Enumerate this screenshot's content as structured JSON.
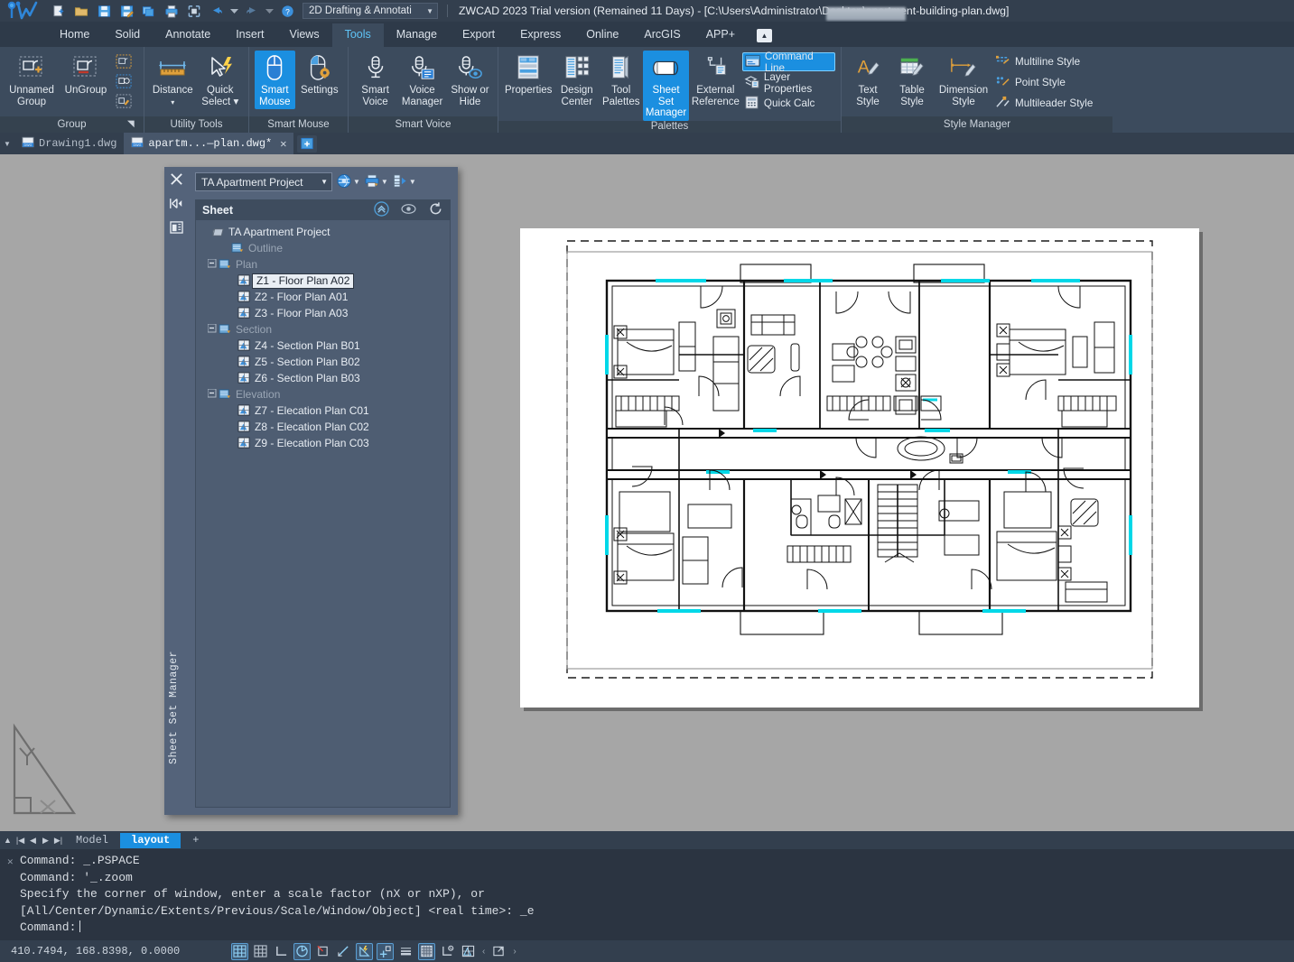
{
  "titlebar": {
    "workspace": "2D Drafting & Annotati",
    "title_prefix": "ZWCAD 2023 Trial version (Remained 11 Days) - [C:\\Users\\Administrator\\Desktop",
    "title_suffix": "\\apartment-building-plan.dwg]",
    "quick_access": [
      {
        "name": "new-icon",
        "label": "New"
      },
      {
        "name": "open-folder-icon",
        "label": "Open"
      },
      {
        "name": "save-icon",
        "label": "Save"
      },
      {
        "name": "save-as-icon",
        "label": "Save As"
      },
      {
        "name": "batch-plot-icon",
        "label": "Batch Plot"
      },
      {
        "name": "print-icon",
        "label": "Plot"
      },
      {
        "name": "print-preview-icon",
        "label": "Print Preview"
      },
      {
        "name": "undo-icon",
        "label": "Undo"
      },
      {
        "name": "undo-dropdown-icon",
        "label": "Undo list"
      },
      {
        "name": "redo-icon",
        "label": "Redo"
      },
      {
        "name": "redo-dropdown-icon",
        "label": "Redo list"
      },
      {
        "name": "help-icon",
        "label": "Help"
      }
    ]
  },
  "ribbon_tabs": [
    {
      "label": "Home",
      "active": false
    },
    {
      "label": "Solid",
      "active": false
    },
    {
      "label": "Annotate",
      "active": false
    },
    {
      "label": "Insert",
      "active": false
    },
    {
      "label": "Views",
      "active": false
    },
    {
      "label": "Tools",
      "active": true
    },
    {
      "label": "Manage",
      "active": false
    },
    {
      "label": "Export",
      "active": false
    },
    {
      "label": "Express",
      "active": false
    },
    {
      "label": "Online",
      "active": false
    },
    {
      "label": "ArcGIS",
      "active": false
    },
    {
      "label": "APP+",
      "active": false
    }
  ],
  "ribbon": {
    "groups": [
      {
        "title": "Group",
        "has_launcher": true,
        "buttons": [
          {
            "label": "Unnamed\nGroup",
            "line1": "Unnamed",
            "line2": "Group",
            "icon": "unnamed-group-icon",
            "selected": false
          },
          {
            "label": "UnGroup",
            "line1": "UnGroup",
            "line2": "",
            "icon": "ungroup-icon",
            "selected": false
          }
        ],
        "small_icons": [
          {
            "name": "group-edit-icon"
          },
          {
            "name": "group-select-icon"
          },
          {
            "name": "group-manager-icon"
          }
        ]
      },
      {
        "title": "Utility Tools",
        "has_launcher": false,
        "buttons": [
          {
            "line1": "Distance",
            "line2": "▾",
            "icon": "distance-icon",
            "selected": false
          },
          {
            "line1": "Quick",
            "line2": "Select ▾",
            "icon": "quick-select-icon",
            "selected": false
          }
        ],
        "small_icons": []
      },
      {
        "title": "Smart Mouse",
        "has_launcher": false,
        "buttons": [
          {
            "line1": "Smart",
            "line2": "Mouse",
            "icon": "smart-mouse-icon",
            "selected": true
          },
          {
            "line1": "Settings",
            "line2": "",
            "icon": "smart-mouse-settings-icon",
            "selected": false
          }
        ],
        "small_icons": []
      },
      {
        "title": "Smart Voice",
        "has_launcher": false,
        "buttons": [
          {
            "line1": "Smart",
            "line2": "Voice",
            "icon": "smart-voice-icon",
            "selected": false
          },
          {
            "line1": "Voice",
            "line2": "Manager",
            "icon": "voice-manager-icon",
            "selected": false
          },
          {
            "line1": "Show or",
            "line2": "Hide",
            "icon": "show-or-hide-icon",
            "selected": false
          }
        ],
        "small_icons": []
      },
      {
        "title": "Palettes",
        "has_launcher": false,
        "buttons": [
          {
            "line1": "Properties",
            "line2": "",
            "icon": "properties-icon",
            "selected": false
          },
          {
            "line1": "Design",
            "line2": "Center",
            "icon": "design-center-icon",
            "selected": false
          },
          {
            "line1": "Tool",
            "line2": "Palettes",
            "icon": "tool-palettes-icon",
            "selected": false
          },
          {
            "line1": "Sheet Set",
            "line2": "Manager",
            "icon": "sheet-set-manager-icon",
            "selected": true
          },
          {
            "line1": "External",
            "line2": "Reference",
            "icon": "external-reference-icon",
            "selected": false
          }
        ],
        "stack_items": [
          {
            "label": "Command Line",
            "icon": "command-line-icon",
            "selected": true
          },
          {
            "label": "Layer Properties",
            "icon": "layer-properties-icon",
            "selected": false
          },
          {
            "label": "Quick Calc",
            "icon": "quick-calc-icon",
            "selected": false
          }
        ]
      },
      {
        "title": "Style Manager",
        "has_launcher": false,
        "buttons": [
          {
            "line1": "Text",
            "line2": "Style",
            "icon": "text-style-icon",
            "selected": false
          },
          {
            "line1": "Table",
            "line2": "Style",
            "icon": "table-style-icon",
            "selected": false
          },
          {
            "line1": "Dimension",
            "line2": "Style",
            "icon": "dimension-style-icon",
            "selected": false
          }
        ],
        "stack_items": [
          {
            "label": "Multiline Style",
            "icon": "multiline-style-icon",
            "selected": false
          },
          {
            "label": "Point Style",
            "icon": "point-style-icon",
            "selected": false
          },
          {
            "label": "Multileader Style",
            "icon": "multileader-style-icon",
            "selected": false
          }
        ]
      }
    ]
  },
  "doc_tabs": [
    {
      "label": "Drawing1.dwg",
      "active": false,
      "closable": false
    },
    {
      "label": "apartm...—plan.dwg*",
      "active": true,
      "closable": true
    }
  ],
  "sheet_set_manager": {
    "vertical_title": "Sheet Set Manager",
    "project_combo": "TA Apartment Project",
    "toolbar": [
      {
        "name": "sheet-set-publish-icon"
      },
      {
        "name": "sheet-set-plot-icon"
      },
      {
        "name": "sheet-set-etransmit-icon"
      }
    ],
    "panel_header": "Sheet",
    "header_icons": [
      {
        "name": "collapse-all-icon"
      },
      {
        "name": "preview-icon"
      },
      {
        "name": "refresh-icon"
      }
    ],
    "tree": [
      {
        "depth": 0,
        "label": "TA Apartment Project",
        "type": "root",
        "expanded": true,
        "selected": false,
        "icon": "sheet-set-root-icon"
      },
      {
        "depth": 1,
        "label": "Outline",
        "type": "subset",
        "expanded": null,
        "selected": false,
        "icon": "subset-icon"
      },
      {
        "depth": 1,
        "label": "Plan",
        "type": "subset",
        "expanded": true,
        "selected": false,
        "icon": "subset-icon"
      },
      {
        "depth": 2,
        "label": "Z1 - Floor Plan A02",
        "type": "sheet",
        "expanded": null,
        "selected": true,
        "icon": "sheet-icon"
      },
      {
        "depth": 2,
        "label": "Z2 - Floor Plan A01",
        "type": "sheet",
        "expanded": null,
        "selected": false,
        "icon": "sheet-icon"
      },
      {
        "depth": 2,
        "label": "Z3 - Floor Plan A03",
        "type": "sheet",
        "expanded": null,
        "selected": false,
        "icon": "sheet-icon"
      },
      {
        "depth": 1,
        "label": "Section",
        "type": "subset",
        "expanded": true,
        "selected": false,
        "icon": "subset-icon"
      },
      {
        "depth": 2,
        "label": "Z4 - Section Plan B01",
        "type": "sheet",
        "expanded": null,
        "selected": false,
        "icon": "sheet-icon"
      },
      {
        "depth": 2,
        "label": "Z5 - Section Plan B02",
        "type": "sheet",
        "expanded": null,
        "selected": false,
        "icon": "sheet-icon"
      },
      {
        "depth": 2,
        "label": "Z6 - Section Plan B03",
        "type": "sheet",
        "expanded": null,
        "selected": false,
        "icon": "sheet-icon"
      },
      {
        "depth": 1,
        "label": "Elevation",
        "type": "subset",
        "expanded": true,
        "selected": false,
        "icon": "subset-icon"
      },
      {
        "depth": 2,
        "label": "Z7 - Elecation Plan C01",
        "type": "sheet",
        "expanded": null,
        "selected": false,
        "icon": "sheet-icon"
      },
      {
        "depth": 2,
        "label": "Z8 - Elecation Plan C02",
        "type": "sheet",
        "expanded": null,
        "selected": false,
        "icon": "sheet-icon"
      },
      {
        "depth": 2,
        "label": "Z9 - Elecation Plan C03",
        "type": "sheet",
        "expanded": null,
        "selected": false,
        "icon": "sheet-icon"
      }
    ]
  },
  "layout_tabs": {
    "nav": [
      "⏮",
      "◀",
      "▶",
      "⏭"
    ],
    "tabs": [
      {
        "label": "Model",
        "active": false
      },
      {
        "label": "layout",
        "active": true
      }
    ],
    "add_label": "+"
  },
  "command_line": {
    "lines": [
      "Command: _.PSPACE",
      "Command: '_.zoom",
      "Specify the corner of window, enter a scale factor (nX or nXP), or",
      "[All/Center/Dynamic/Extents/Previous/Scale/Window/Object] <real time>: _e",
      "Command:"
    ],
    "prompt": "Command:"
  },
  "status_bar": {
    "coordinates": "410.7494,  168.8398,  0.0000",
    "toggles": [
      {
        "name": "snap-icon",
        "on": true
      },
      {
        "name": "grid-icon",
        "on": false
      },
      {
        "name": "ortho-icon",
        "on": false
      },
      {
        "name": "polar-tracking-icon",
        "on": true
      },
      {
        "name": "osnap-icon",
        "on": false
      },
      {
        "name": "otrack-icon",
        "on": false
      },
      {
        "name": "dynamic-ucs-icon",
        "on": true
      },
      {
        "name": "dynamic-input-icon",
        "on": true
      },
      {
        "name": "lineweight-icon",
        "on": false
      },
      {
        "name": "transparency-icon",
        "on": true
      },
      {
        "name": "quick-properties-icon",
        "on": false
      },
      {
        "name": "selection-cycling-icon",
        "on": false
      },
      {
        "name": "annotation-scale-left-icon",
        "on": false
      },
      {
        "name": "fullscreen-icon",
        "on": false
      },
      {
        "name": "annotation-scale-right-icon",
        "on": false
      }
    ]
  },
  "colors": {
    "accent": "#1b8fe0",
    "ribbon_bg": "#3c4b5d",
    "titlebar_bg": "#333f4e",
    "canvas_bg": "#a6a6a6",
    "paper": "#ffffff",
    "panel_bg": "#54637a",
    "tree_bg": "#4e5d72",
    "highlight_cyan": "#00e5ef"
  }
}
